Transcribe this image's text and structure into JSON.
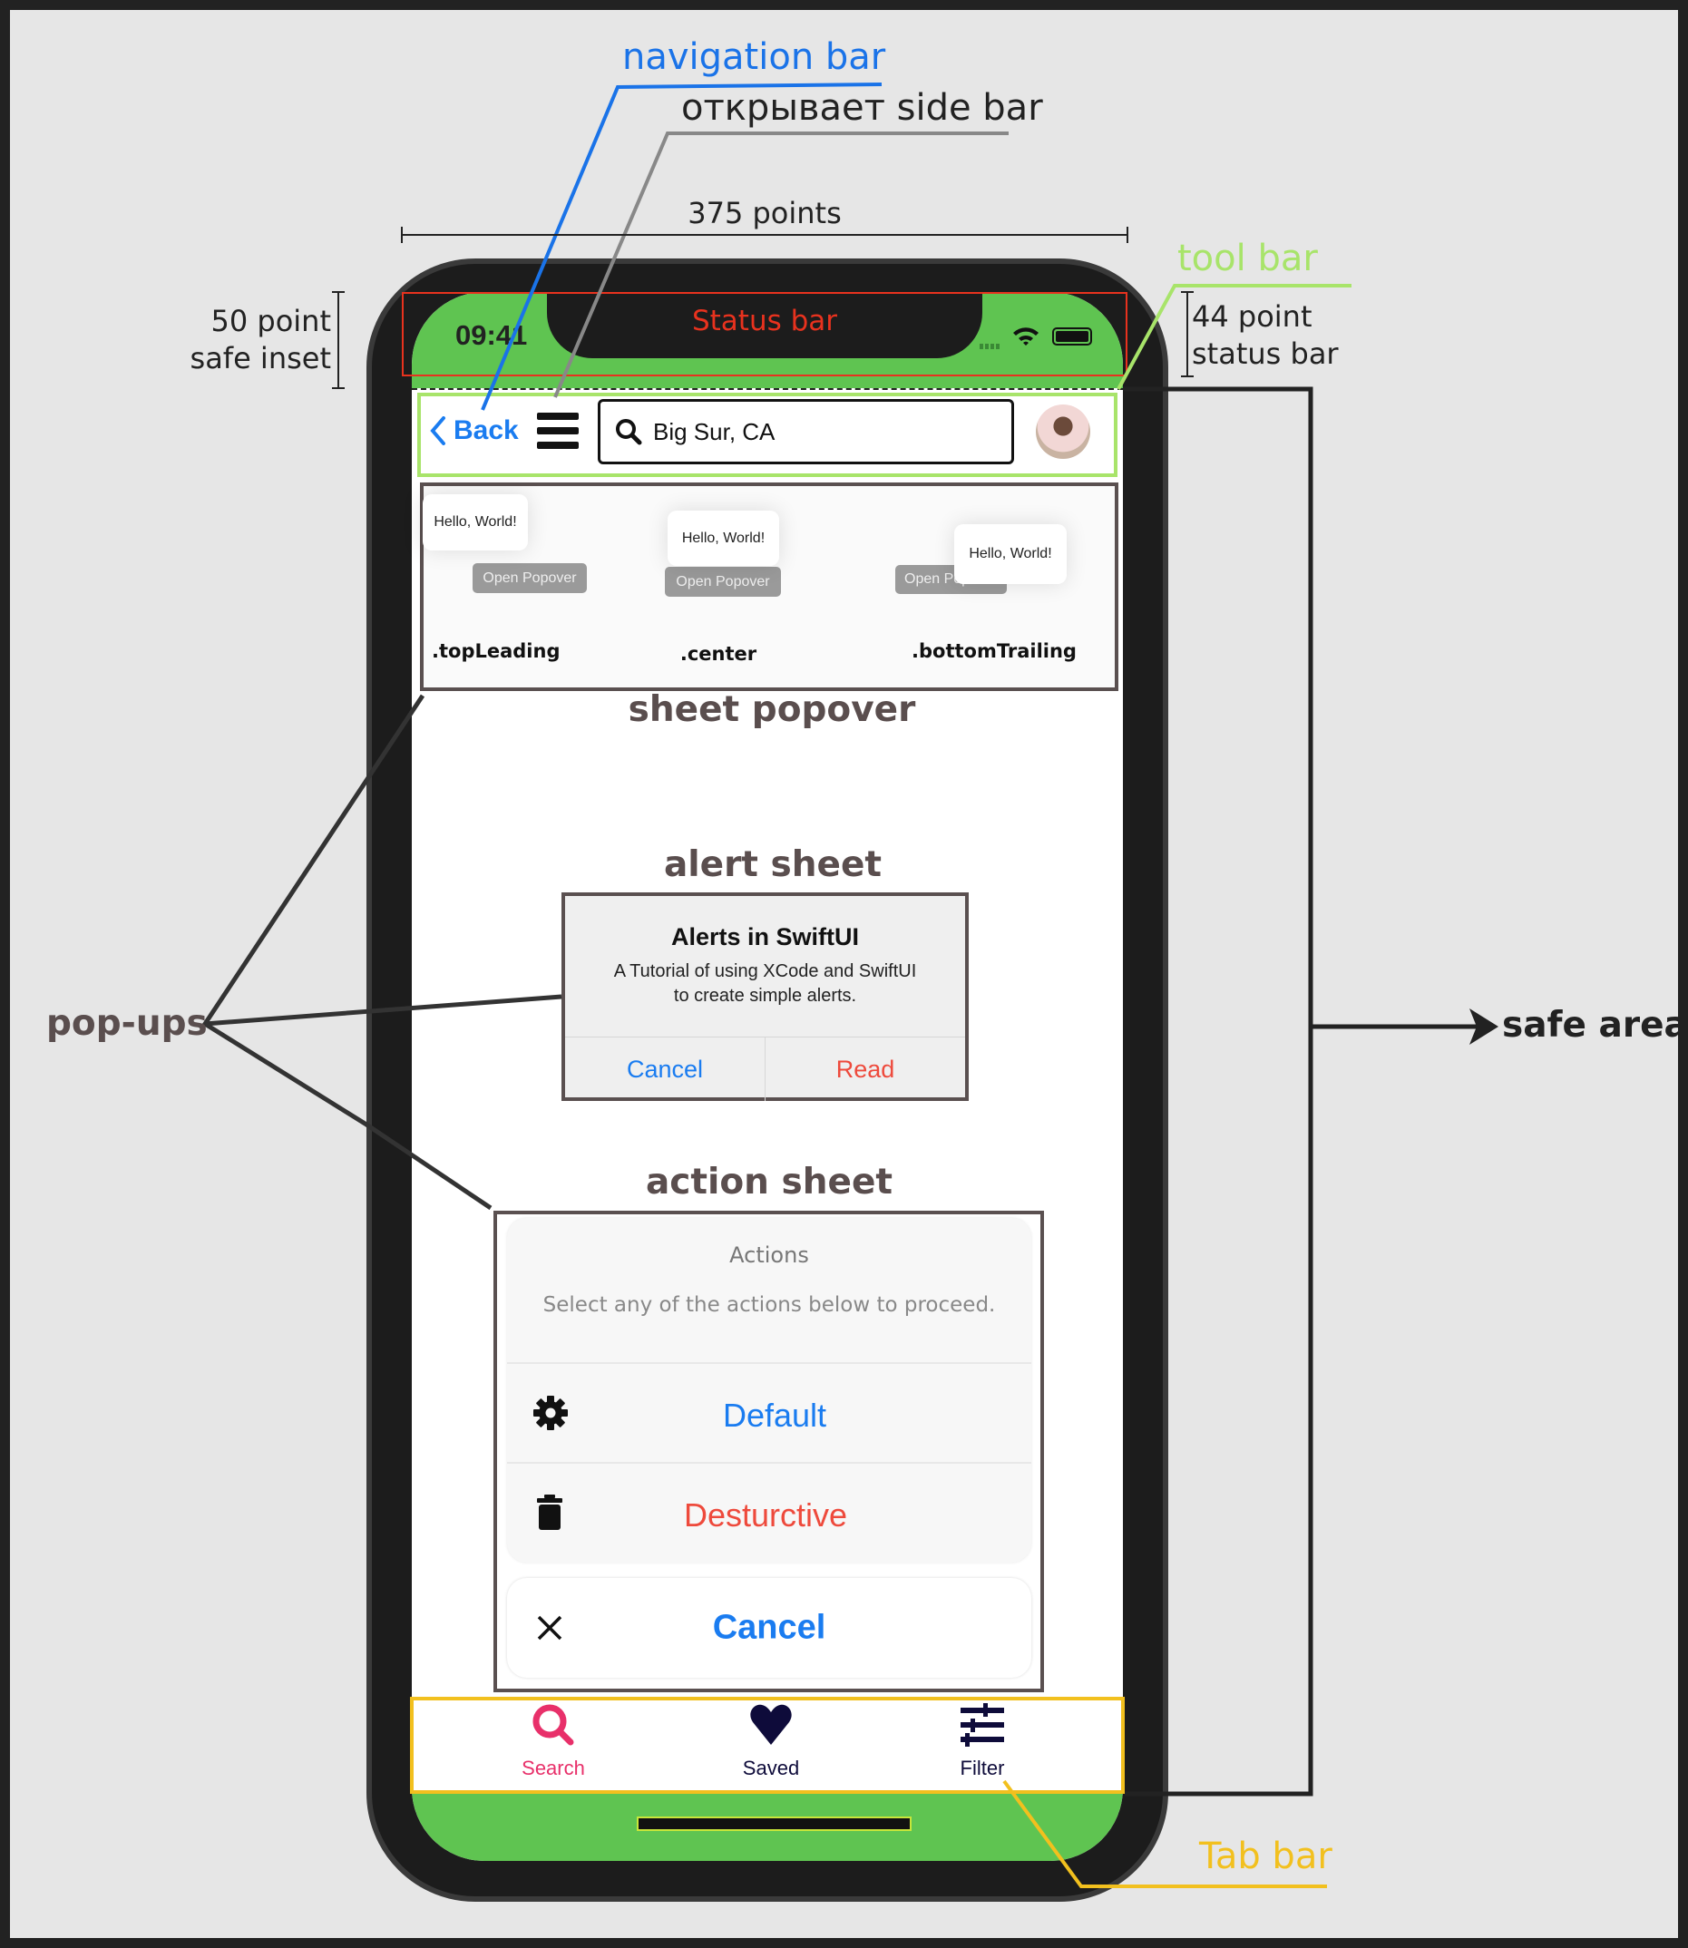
{
  "annotations": {
    "navigation_bar": "navigation bar",
    "opens_side_bar": "открывает side bar",
    "width": "375 points",
    "tool_bar": "tool bar",
    "status_bar_height_1": "44 point",
    "status_bar_height_2": "status bar",
    "safe_inset_1": "50 point",
    "safe_inset_2": "safe inset",
    "status_bar": "Status bar",
    "pop_ups": "pop-ups",
    "safe_area": "safe area",
    "tab_bar": "Tab bar",
    "sheet_popover": "sheet popover",
    "alert_sheet": "alert sheet",
    "action_sheet": "action sheet"
  },
  "colors": {
    "nav_label": "#1a73e8",
    "tool_bar": "#a8e46a",
    "status_bar": "#e8321e",
    "tab_bar": "#f2c01e",
    "phone_green": "#5fc451",
    "ios_blue": "#1a7cf0",
    "ios_red": "#ee4a3c",
    "tab_active": "#e8306a",
    "tab_icon": "#0e0b3a"
  },
  "status": {
    "time": "09:41",
    "icons": [
      "signal-icon",
      "wifi-icon",
      "battery-icon"
    ]
  },
  "nav": {
    "back": "Back",
    "search_value": "Big Sur, CA",
    "icons": [
      "chevron-left-icon",
      "hamburger-icon",
      "search-icon",
      "avatar"
    ]
  },
  "popovers": [
    {
      "bubble": "Hello, World!",
      "button": "Open Popover",
      "label": ".topLeading"
    },
    {
      "bubble": "Hello, World!",
      "button": "Open Popover",
      "label": ".center"
    },
    {
      "bubble": "Hello, World!",
      "button": "Open Popover",
      "label": ".bottomTrailing"
    }
  ],
  "alert": {
    "title": "Alerts in SwiftUI",
    "message_1": "A Tutorial of using XCode and SwiftUI",
    "message_2": "to create simple alerts.",
    "cancel": "Cancel",
    "read": "Read"
  },
  "action_sheet": {
    "title": "Actions",
    "message": "Select any of the actions below to proceed.",
    "items": [
      {
        "label": "Default",
        "icon": "gear-icon"
      },
      {
        "label": "Desturctive",
        "icon": "trash-icon"
      }
    ],
    "cancel": "Cancel",
    "cancel_icon": "close-icon"
  },
  "tabs": [
    {
      "label": "Search",
      "icon": "search-icon",
      "active": true
    },
    {
      "label": "Saved",
      "icon": "heart-icon"
    },
    {
      "label": "Filter",
      "icon": "sliders-icon"
    }
  ]
}
